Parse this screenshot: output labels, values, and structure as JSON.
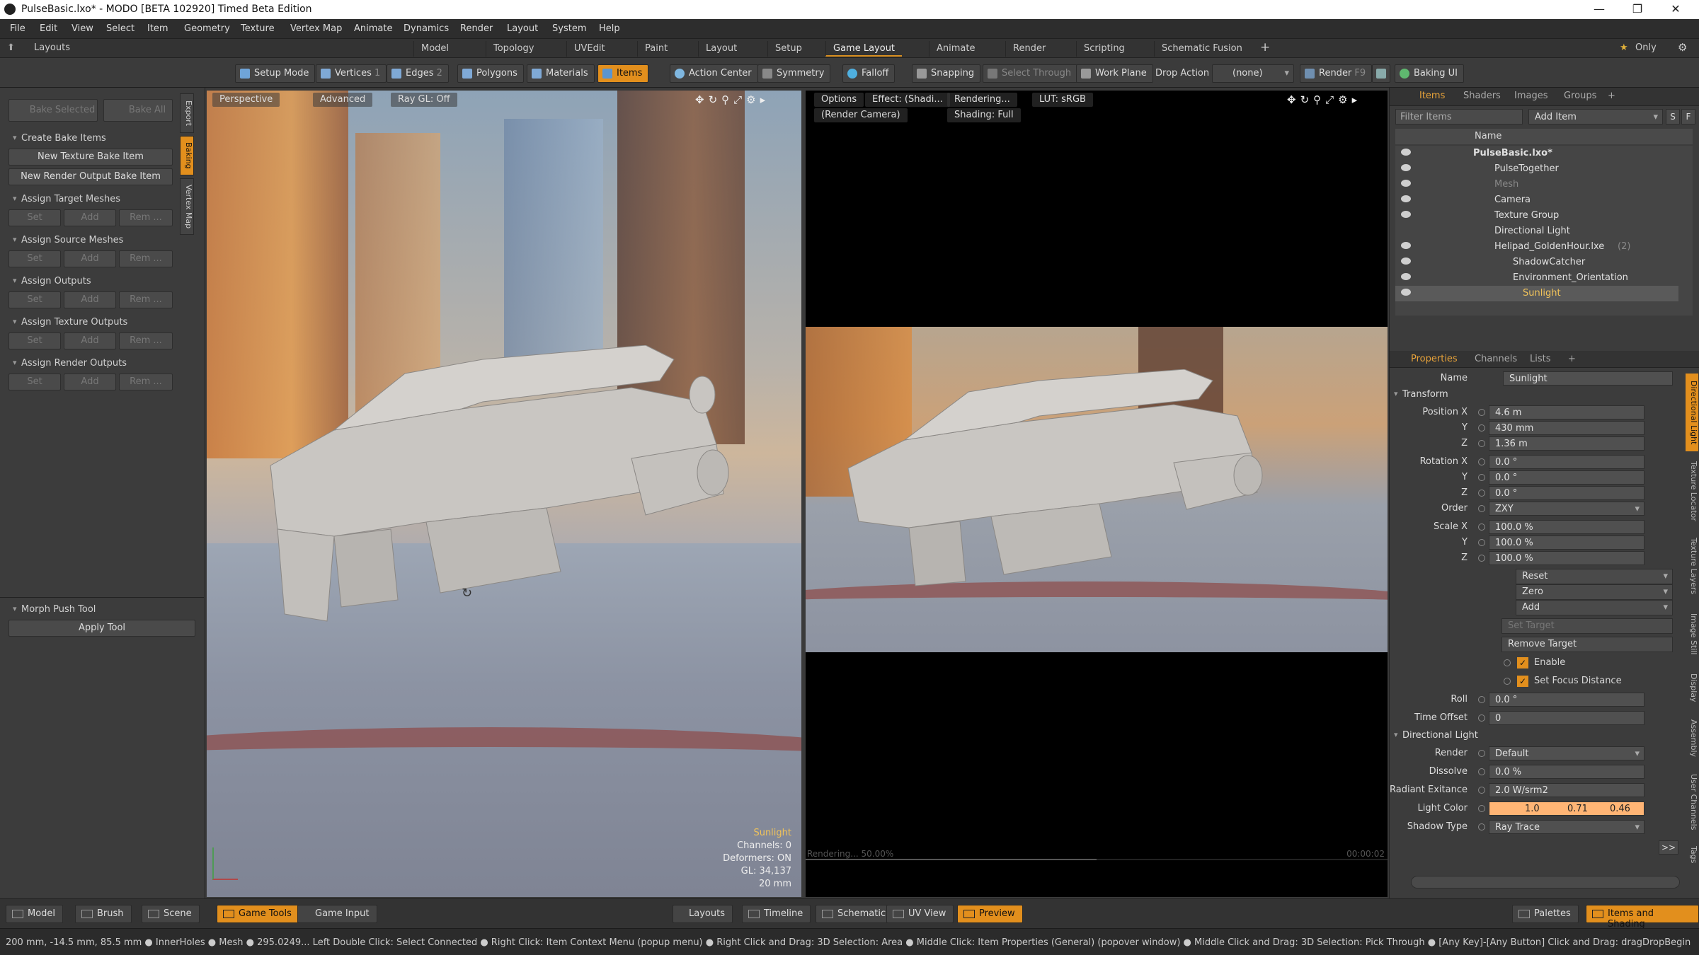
{
  "window": {
    "title": "PulseBasic.lxo* - MODO [BETA 102920] Timed Beta Edition",
    "controls": [
      "—",
      "❐",
      "✕"
    ]
  },
  "menu": [
    "File",
    "Edit",
    "View",
    "Select",
    "Item",
    "Geometry",
    "Texture",
    "Vertex Map",
    "Animate",
    "Dynamics",
    "Render",
    "Layout",
    "System",
    "Help"
  ],
  "layout_row": {
    "label": "Layouts",
    "tabs": [
      "Model",
      "Topology",
      "UVEdit",
      "Paint",
      "Layout",
      "Setup",
      "Game Layout",
      "Animate",
      "Render",
      "Scripting",
      "Schematic Fusion"
    ],
    "active_tab": "Game Layout",
    "add": "+",
    "only_label": "Only",
    "star": "★"
  },
  "toolbar": {
    "setup_mode": "Setup Mode",
    "vertices": "Vertices",
    "vertices_n": "1",
    "edges": "Edges",
    "edges_n": "2",
    "polygons": "Polygons",
    "materials": "Materials",
    "items": "Items",
    "action_center": "Action Center",
    "symmetry": "Symmetry",
    "falloff": "Falloff",
    "snapping": "Snapping",
    "select_through": "Select Through",
    "work_plane": "Work Plane",
    "drop_action": "Drop Action",
    "drop_value": "(none)",
    "render": "Render",
    "render_key": "F9",
    "baking_ui": "Baking UI"
  },
  "left_panel": {
    "bake_selected": "Bake Selected",
    "bake_all": "Bake All",
    "vtabs": [
      "Export",
      "Baking",
      "Vertex Map"
    ],
    "active_vtab": "Baking",
    "sections": {
      "create": "Create Bake Items",
      "new_texture": "New Texture Bake Item",
      "new_render": "New Render Output Bake Item",
      "target_meshes": "Assign Target Meshes",
      "source_meshes": "Assign Source Meshes",
      "outputs": "Assign Outputs",
      "texture_outputs": "Assign Texture Outputs",
      "render_outputs": "Assign Render Outputs",
      "morph": "Morph Push Tool",
      "apply": "Apply Tool"
    },
    "set": "Set",
    "add": "Add",
    "rem": "Rem ..."
  },
  "viewport_left": {
    "view": "Perspective",
    "mode": "Advanced",
    "raygl": "Ray GL: Off",
    "info": {
      "item": "Sunlight",
      "channels": "Channels: 0",
      "deformers": "Deformers: ON",
      "gl": "GL: 34,137",
      "distance": "20 mm"
    }
  },
  "viewport_right": {
    "options": "Options",
    "effect": "Effect: (Shadi...",
    "rendering": "Rendering...",
    "lut": "LUT: sRGB",
    "camera": "(Render Camera)",
    "shading": "Shading: Full",
    "progress": "Rendering... 50.00%",
    "time": "00:00:02"
  },
  "items_panel": {
    "tabs": [
      "Items",
      "Shaders",
      "Images",
      "Groups"
    ],
    "active_tab": "Items",
    "filter_placeholder": "Filter Items",
    "add_item": "Add Item",
    "col_name": "Name",
    "rows": [
      {
        "name": "PulseBasic.lxo*",
        "depth": 0
      },
      {
        "name": "PulseTogether",
        "depth": 1
      },
      {
        "name": "Mesh",
        "depth": 1
      },
      {
        "name": "Camera",
        "depth": 1
      },
      {
        "name": "Texture Group",
        "depth": 1
      },
      {
        "name": "Directional Light",
        "depth": 1
      },
      {
        "name": "Helipad_GoldenHour.lxe",
        "depth": 1,
        "count": "(2)"
      },
      {
        "name": "ShadowCatcher",
        "depth": 2
      },
      {
        "name": "Environment_Orientation",
        "depth": 2
      },
      {
        "name": "Sunlight",
        "depth": 3,
        "selected": true
      }
    ]
  },
  "properties": {
    "tabs": [
      "Properties",
      "Channels",
      "Lists"
    ],
    "active_tab": "Properties",
    "name_label": "Name",
    "name_value": "Sunlight",
    "transform": "Transform",
    "position_label": "Position X",
    "position": [
      "4.6 m",
      "430 mm",
      "1.36 m"
    ],
    "rotation_label": "Rotation X",
    "rotation": [
      "0.0 °",
      "0.0 °",
      "0.0 °"
    ],
    "order_label": "Order",
    "order": "ZXY",
    "scale_label": "Scale X",
    "scale": [
      "100.0 %",
      "100.0 %",
      "100.0 %"
    ],
    "axis_y": "Y",
    "axis_z": "Z",
    "reset": "Reset",
    "zero": "Zero",
    "add": "Add",
    "set_target": "Set Target",
    "remove_target": "Remove Target",
    "enable": "Enable",
    "set_focus": "Set Focus Distance",
    "roll_label": "Roll",
    "roll": "0.0 °",
    "time_offset_label": "Time Offset",
    "time_offset": "0",
    "dir_light": "Directional Light",
    "render_label": "Render",
    "render": "Default",
    "dissolve_label": "Dissolve",
    "dissolve": "0.0 %",
    "radiant_label": "Radiant Exitance",
    "radiant": "2.0 W/srm2",
    "light_color_label": "Light Color",
    "light_color": [
      "1.0",
      "0.71",
      "0.46"
    ],
    "shadow_label": "Shadow Type",
    "shadow": "Ray Trace",
    "side_tabs": [
      "Directional Light",
      "Texture Locator",
      "Texture Layers",
      "Image Still",
      "Display",
      "Assembly",
      "User Channels",
      "Tags"
    ],
    "more": ">>"
  },
  "bottom_bar": {
    "left": [
      "Model",
      "Brush",
      "Scene",
      "Game Tools",
      "Game Input"
    ],
    "active_left": "Game Tools",
    "center": [
      "Layouts",
      "Timeline",
      "Schematic",
      "UV View",
      "Preview"
    ],
    "active_center": "Preview",
    "right": [
      "Palettes",
      "Items and Shading"
    ],
    "active_right": "Items and Shading"
  },
  "status_bar": "200 mm, -14.5 mm, 85.5 mm ● InnerHoles ● Mesh ● 295.0249...  Left Double Click: Select Connected ● Right Click: Item Context Menu (popup menu) ● Right Click and Drag: 3D Selection: Area ● Middle Click: Item Properties (General) (popover window) ● Middle Click and Drag: 3D Selection: Pick Through ● [Any Key]-[Any Button] Click and Drag: dragDropBegin",
  "colors": {
    "accent": "#e28f1d",
    "selected_text": "#f1c35a",
    "light_color_swatch": "#ffb575"
  }
}
